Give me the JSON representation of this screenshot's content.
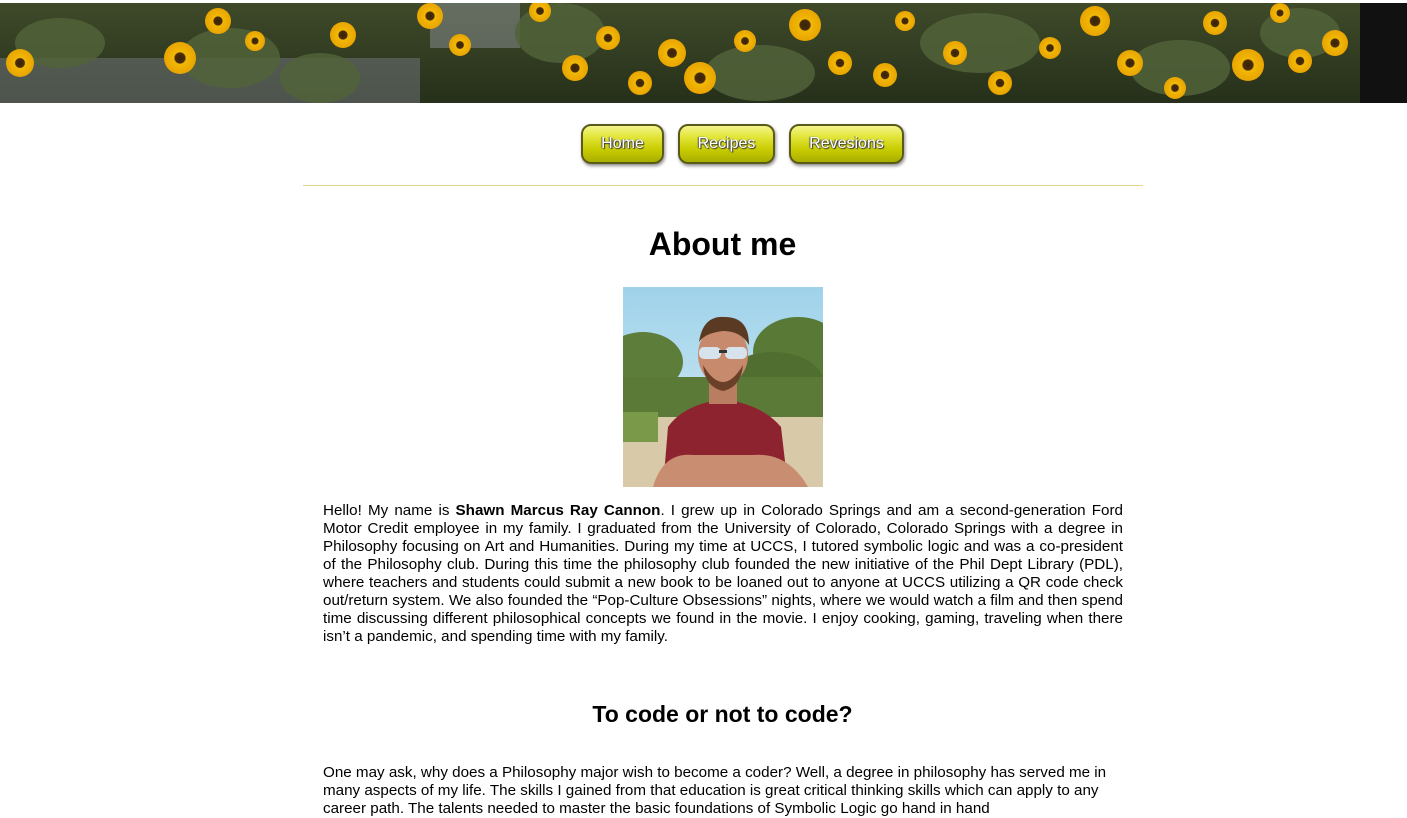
{
  "banner": {
    "alt": "sunflower field banner"
  },
  "nav": {
    "home": "Home",
    "recipes": "Recipes",
    "revisions": "Revesions"
  },
  "about": {
    "title": "About me",
    "intro_hello": "Hello! My name is ",
    "name": "Shawn Marcus Ray Cannon",
    "intro_rest": ". I grew up in Colorado Springs and am a second-generation Ford Motor Credit employee in my family. I graduated from the University of Colorado, Colorado Springs with a degree in Philosophy focusing on Art and Humanities. During my time at UCCS, I tutored symbolic logic and was a co-president of the Philosophy club. During this time the philosophy club founded the new initiative of the Phil Dept Library (PDL), where teachers and students could submit a new book to be loaned out to anyone at UCCS utilizing a QR code check out/return system. We also founded the “Pop-Culture Obsessions” nights, where we would watch a film and then spend time discussing different philosophical concepts we found in the movie. I enjoy cooking, gaming, traveling when there isn’t a pandemic, and spending time with my family."
  },
  "code_section": {
    "title": "To code or not to code?",
    "body": "One may ask, why does a Philosophy major wish to become a coder? Well, a degree in philosophy has served me in many aspects of my life. The skills I gained from that education is great critical thinking skills which can apply to any career path. The talents needed to master the basic foundations of Symbolic Logic go hand in hand"
  },
  "colors": {
    "button_top": "#f4f48a",
    "button_bottom": "#a9ae00",
    "divider": "#e6d88a"
  }
}
